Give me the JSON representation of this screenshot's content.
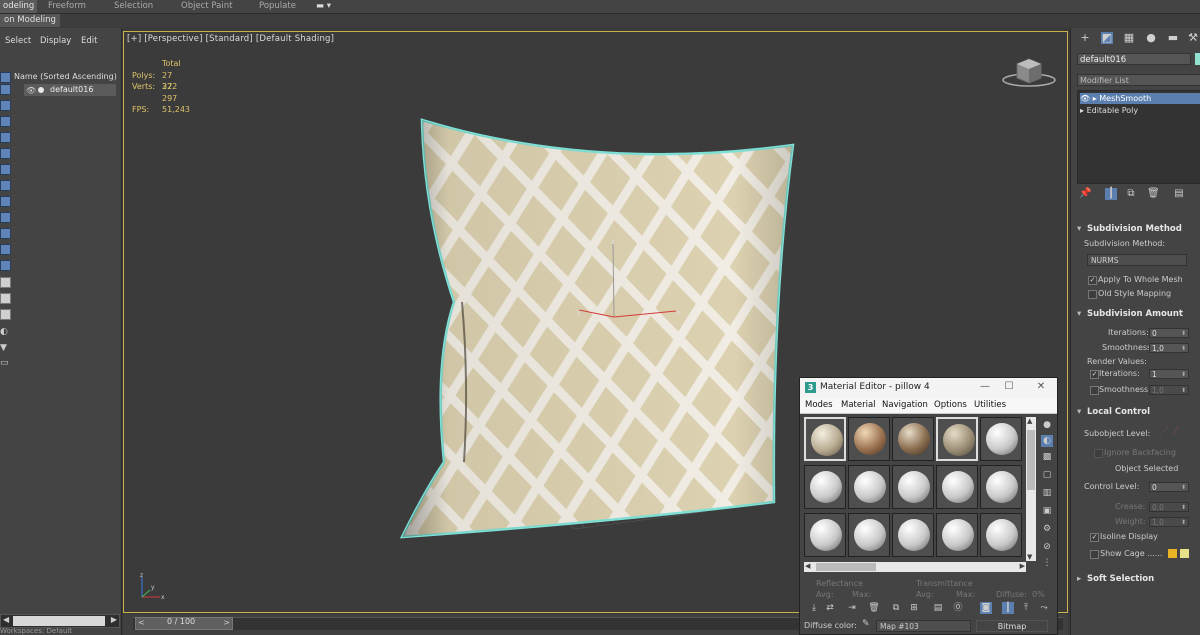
{
  "ribbon": {
    "tabs": [
      "odeling",
      "Freeform",
      "Selection",
      "Object Paint",
      "Populate"
    ],
    "sub_tab": "on Modeling"
  },
  "scene_explorer": {
    "menu": [
      "Select",
      "Display",
      "Edit"
    ],
    "header": "Name (Sorted Ascending)",
    "object": "default016"
  },
  "viewport": {
    "label": "[+] [Perspective] [Standard] [Default Shading]",
    "stats": {
      "total_label": "Total",
      "polys_label": "Polys:",
      "polys": "27 322",
      "verts_label": "Verts:",
      "verts": "27 297",
      "fps_label": "FPS:",
      "fps": "51,243"
    },
    "axis_labels": {
      "z": "z",
      "x": "x",
      "y": "y"
    }
  },
  "timeline": {
    "frame": "0 / 100"
  },
  "bottom_left": {
    "text": "Workspaces: Default"
  },
  "command_panel": {
    "object_name": "default016",
    "object_color": "#8fe3d0",
    "modifier_list": "Modifier List",
    "stack": [
      "MeshSmooth",
      "Editable Poly"
    ],
    "subdivision_method": {
      "title": "Subdivision Method",
      "method_label": "Subdivision Method:",
      "method": "NURMS",
      "apply_whole": "Apply To Whole Mesh",
      "old_style": "Old Style Mapping"
    },
    "subdivision_amount": {
      "title": "Subdivision Amount",
      "iterations_label": "Iterations:",
      "iterations": "0",
      "smoothness_label": "Smoothness:",
      "smoothness": "1,0",
      "render_values": "Render Values:",
      "r_iterations_label": "Iterations:",
      "r_iterations": "1",
      "r_smoothness_label": "Smoothness:",
      "r_smoothness": "1,0"
    },
    "local_control": {
      "title": "Local Control",
      "subobject_label": "Subobject Level:",
      "ignore_backfacing": "Ignore Backfacing",
      "object_selected": "Object Selected",
      "control_level_label": "Control Level:",
      "control_level": "0",
      "crease_label": "Crease:",
      "crease": "0,0",
      "weight_label": "Weight:",
      "weight": "1,0",
      "isoline": "Isoline Display",
      "show_cage": "Show Cage ......",
      "cage_color_1": "#e8b425",
      "cage_color_2": "#e6e08a"
    },
    "soft_selection": {
      "title": "Soft Selection"
    }
  },
  "material_editor": {
    "title": "Material Editor - pillow 4",
    "menu": [
      "Modes",
      "Material",
      "Navigation",
      "Options",
      "Utilities"
    ],
    "reflectance_label": "Reflectance",
    "transmittance_label": "Transmittance",
    "avg_label": "Avg:",
    "max_label": "Max:",
    "diffuse_small_label": "Diffuse:",
    "diffuse_pct": "0%",
    "diffuse_color_label": "Diffuse color:",
    "map_name": "Map #103",
    "map_type": "Bitmap"
  }
}
